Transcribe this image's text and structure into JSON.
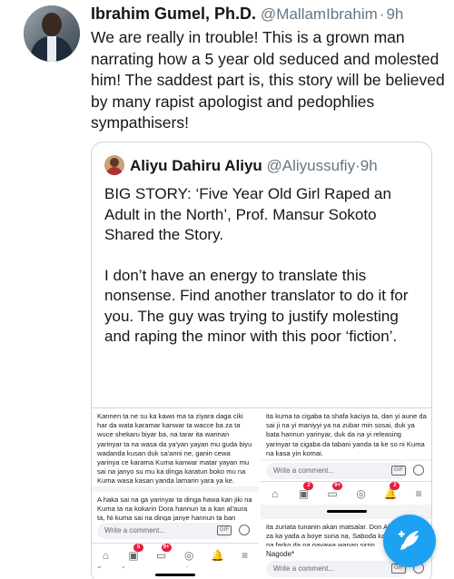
{
  "tweet": {
    "author_name": "Ibrahim Gumel, Ph.D.",
    "author_handle": "@MallamIbrahim",
    "separator": "·",
    "time": "9h",
    "text": "We are really in trouble! This is a grown man narrating how a 5 year old seduced and molested him! The saddest part is, this story will be believed by many rapist apologist and pedophlies sympathisers!"
  },
  "quote": {
    "author_name": "Aliyu Dahiru Aliyu",
    "author_handle": "@Aliyussufiy",
    "separator": "·",
    "time": "9h",
    "paragraph1": "BIG STORY: ‘Five Year Old Girl Raped an Adult in the North’, Prof. Mansur Sokoto Shared the Story.",
    "paragraph2": "I don’t have an energy to translate this nonsense. Find another translator to do it for you. The guy was trying to justify molesting and raping the minor with this poor ‘fiction’."
  },
  "media": {
    "left": {
      "post_top": "Kannen ta ne su ka kawo ma ta ziyara daga ciki har da wata karamar kanwar ta wacce ba za ta wuce shekaru biyar ba, na tarar ita wannan yarinyar ta na wasa da ya'yan yayan mu guda biyu wadanda kusan duk sa'anni ne, ganin cewa yarinya ce karama Kuma kanwar matar yayan mu sai na janyo su mu ka dinga karatun boko mu na Kuma wasa kasan yanda lamarin yara ya ke.",
      "post_bottom": "A haka sai na ga yarinyar ta dinga hawa kan jiki na Kuma ta na kokarin Dora hannun ta a kan al'aura ta, Ni kuma sai na dinga janye hannun ta ban kawo komai a rai na ba duba da cewa yarinya ce, a haka dai tunani na ya canza saboda ta ki daina taba min al'aura, kuma al'aura ta ta fara mikewa abun ka da wanda bai saba ba. Sai na ce su wuce gaba daya a haka na kore su,",
      "comment_placeholder": "Write a comment...",
      "gif_label": "GIF",
      "badges": [
        "5",
        "9+"
      ]
    },
    "right": {
      "post_top": "ita kuma ta cigaba ta shafa kaciya ta, dan yi aune da sai ji na yi maniyyi ya na zubar min sosai, duk ya bata hannun yarinyar, duk da na yi releasing yarinyar ta cigaba da tabani yanda ta ke so ni Kuma na kasa yin komai.",
      "post_bottom": "ita zuriata tunanin akan matsalar. Don Allah idan na za ka yada a boye suna na, Saboda kai ne mutum na farko da na gayawa wanan sirrin.",
      "signature": "Nagode*",
      "comment_placeholder": "Write a comment...",
      "gif_label": "GIF",
      "badges": [
        "2",
        "9+",
        "2"
      ]
    }
  },
  "icons": {
    "home": "home-icon",
    "marketplace": "store-icon",
    "groups": "groups-icon",
    "notifications": "bell-icon",
    "menu": "menu-icon",
    "compose": "compose-feather-icon"
  },
  "colors": {
    "accent": "#1da1f2",
    "secondary_text": "#657786",
    "border": "#ccd6dd",
    "facebook_blue": "#1877f2",
    "badge_red": "#e41e3f"
  }
}
